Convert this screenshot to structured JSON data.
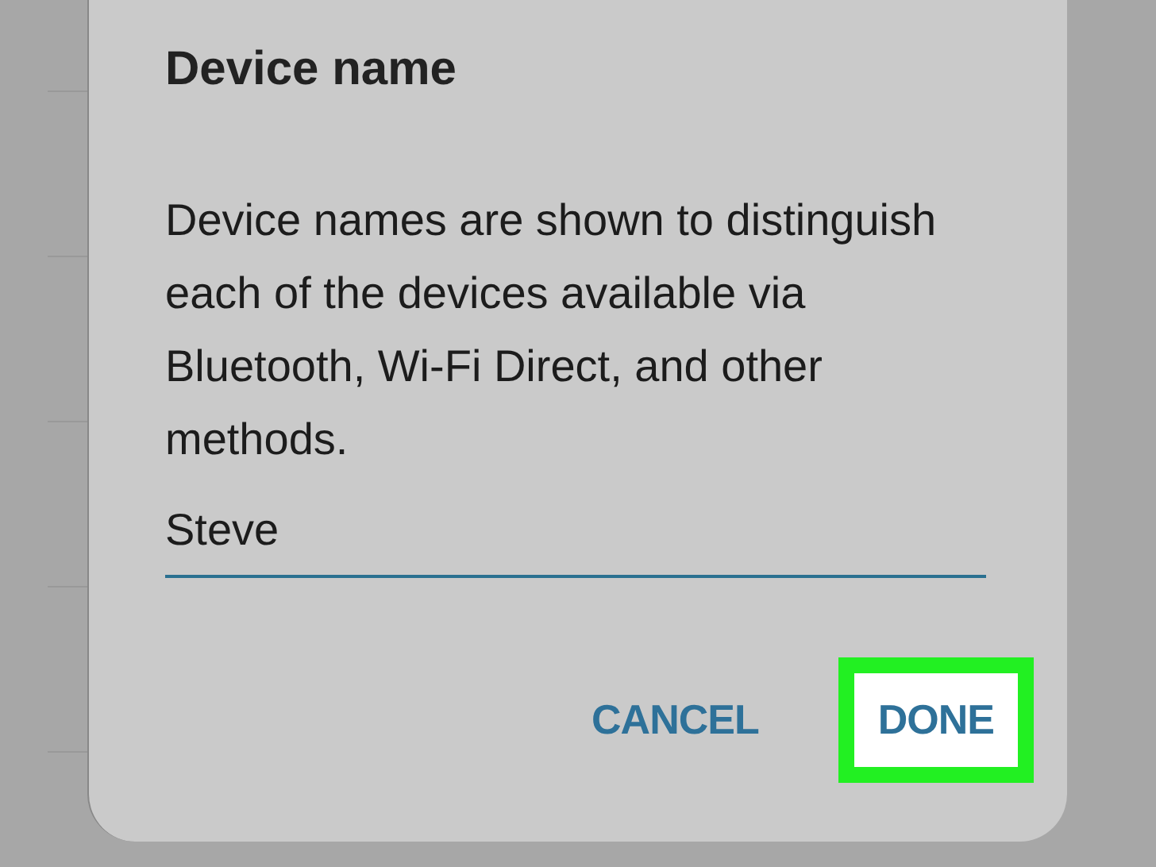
{
  "dialog": {
    "title": "Device name",
    "message": "Device names are shown to distinguish each of the devices available via Bluetooth, Wi-Fi Direct, and other methods.",
    "field": {
      "value": "Steve"
    },
    "buttons": [
      {
        "label": "CANCEL",
        "highlighted": false
      },
      {
        "label": "DONE",
        "highlighted": true
      }
    ]
  }
}
